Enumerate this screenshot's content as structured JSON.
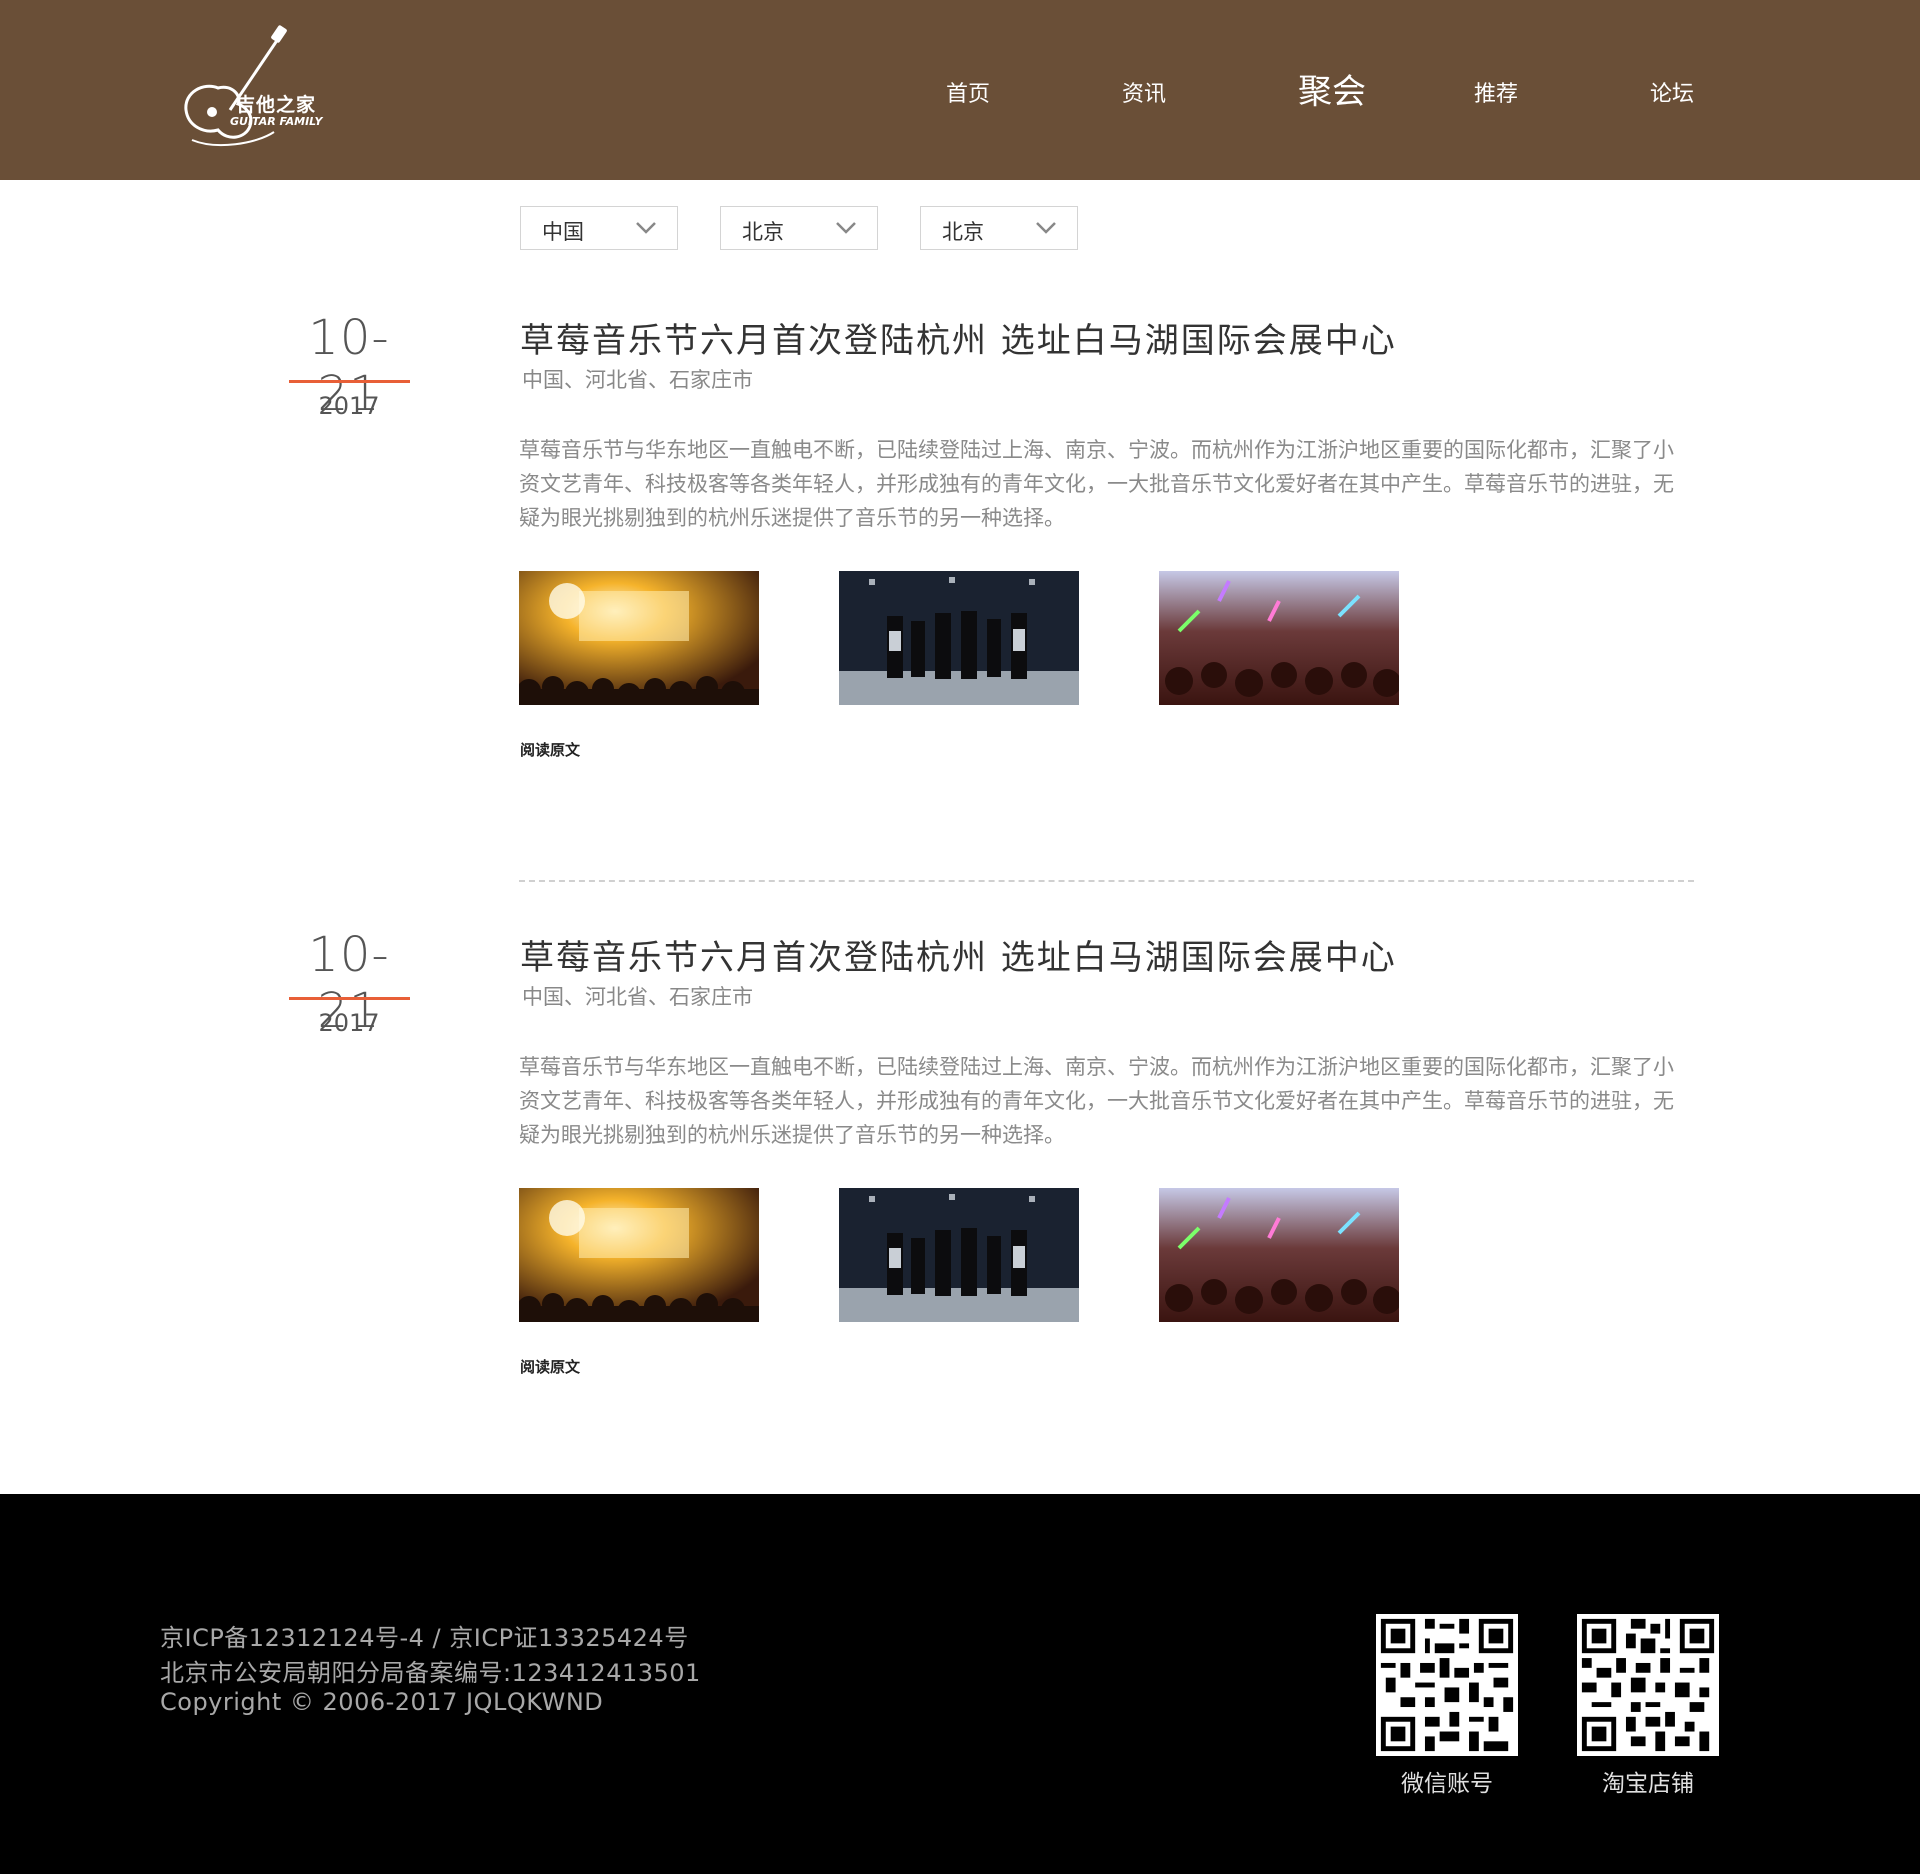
{
  "brand": {
    "name_cn": "吉他之家",
    "name_en": "GUITAR FAMILY"
  },
  "nav": {
    "items": [
      {
        "label": "首页"
      },
      {
        "label": "资讯"
      },
      {
        "label": "聚会",
        "active": true
      },
      {
        "label": "推荐"
      },
      {
        "label": "论坛"
      }
    ]
  },
  "filters": [
    {
      "value": "中国"
    },
    {
      "value": "北京"
    },
    {
      "value": "北京"
    }
  ],
  "articles": [
    {
      "date_day": "10-21",
      "date_year": "2017",
      "title": "草莓音乐节六月首次登陆杭州 选址白马湖国际会展中心",
      "location": "中国、河北省、石家庄市",
      "body": "草莓音乐节与华东地区一直触电不断，已陆续登陆过上海、南京、宁波。而杭州作为江浙沪地区重要的国际化都市，汇聚了小资文艺青年、科技极客等各类年轻人，并形成独有的青年文化，一大批音乐节文化爱好者在其中产生。草莓音乐节的进驻，无疑为眼光挑剔独到的杭州乐迷提供了音乐节的另一种选择。",
      "read_more": "阅读原文",
      "photos": [
        "concert-stage-photo",
        "band-group-photo",
        "crowd-glowsticks-photo"
      ]
    },
    {
      "date_day": "10-21",
      "date_year": "2017",
      "title": "草莓音乐节六月首次登陆杭州 选址白马湖国际会展中心",
      "location": "中国、河北省、石家庄市",
      "body": "草莓音乐节与华东地区一直触电不断，已陆续登陆过上海、南京、宁波。而杭州作为江浙沪地区重要的国际化都市，汇聚了小资文艺青年、科技极客等各类年轻人，并形成独有的青年文化，一大批音乐节文化爱好者在其中产生。草莓音乐节的进驻，无疑为眼光挑剔独到的杭州乐迷提供了音乐节的另一种选择。",
      "read_more": "阅读原文",
      "photos": [
        "concert-stage-photo",
        "band-group-photo",
        "crowd-glowsticks-photo"
      ]
    }
  ],
  "footer": {
    "lines": [
      "京ICP备12312124号-4 / 京ICP证13325424号",
      "北京市公安局朝阳分局备案编号:123412413501",
      "Copyright © 2006-2017 JQLQKWND"
    ],
    "qr_codes": [
      {
        "label": "微信账号"
      },
      {
        "label": "淘宝店铺"
      }
    ]
  },
  "colors": {
    "header_bg": "#6a4f37",
    "accent": "#e85f37",
    "footer_bg": "#000000"
  }
}
